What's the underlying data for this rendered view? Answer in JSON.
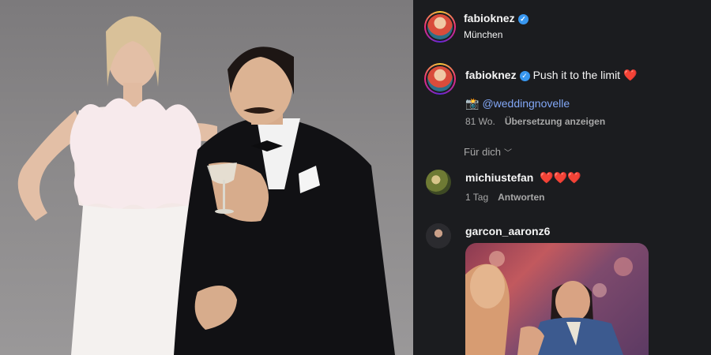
{
  "post": {
    "username": "fabioknez",
    "location": "München"
  },
  "caption": {
    "username": "fabioknez",
    "text": "Push it to the limit",
    "emoji": "❤️",
    "camera_emoji": "📸",
    "mention": "@weddingnovelle",
    "age": "81 Wo.",
    "translate_label": "Übersetzung anzeigen"
  },
  "comments_filter": {
    "label": "Für dich",
    "icon": "chevron-down-icon"
  },
  "comments": [
    {
      "username": "michiustefan",
      "text": "❤️❤️❤️",
      "age": "1 Tag",
      "reply_label": "Antworten"
    },
    {
      "username": "garcon_aaronz6",
      "media": "gif"
    }
  ],
  "colors": {
    "background": "#1b1c1f",
    "verified": "#3897f0",
    "mention": "#82a7f6",
    "heart": "#ff3040",
    "meta": "#a8a8a8"
  }
}
